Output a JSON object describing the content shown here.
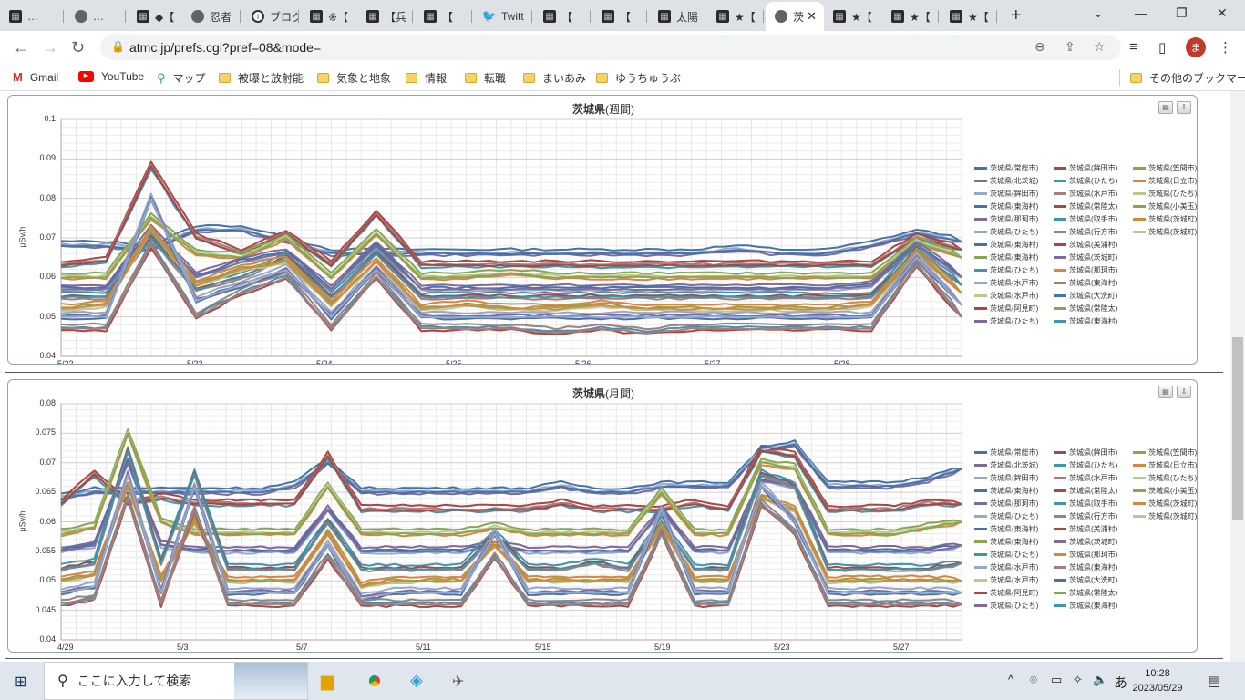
{
  "browser": {
    "tabs": [
      {
        "label": "…",
        "icon": "site-icon",
        "active": false
      },
      {
        "label": "…",
        "icon": "globe-icon",
        "active": false
      },
      {
        "label": "◆【",
        "icon": "site-icon",
        "active": false
      },
      {
        "label": "忍者",
        "icon": "globe-icon",
        "active": false
      },
      {
        "label": "ブログ",
        "icon": "info-icon",
        "active": false
      },
      {
        "label": "※【",
        "icon": "site-icon",
        "active": false
      },
      {
        "label": "【兵",
        "icon": "site-icon",
        "active": false
      },
      {
        "label": "【",
        "icon": "site-icon",
        "active": false
      },
      {
        "label": "Twitt",
        "icon": "twitter-icon",
        "active": false
      },
      {
        "label": "【",
        "icon": "site-icon",
        "active": false
      },
      {
        "label": "【",
        "icon": "site-icon",
        "active": false
      },
      {
        "label": "太陽",
        "icon": "site-icon",
        "active": false
      },
      {
        "label": "★【",
        "icon": "site-icon",
        "active": false
      },
      {
        "label": "茨",
        "icon": "globe-icon",
        "active": true
      },
      {
        "label": "★【",
        "icon": "site-icon",
        "active": false
      },
      {
        "label": "★【",
        "icon": "site-icon",
        "active": false
      },
      {
        "label": "★【",
        "icon": "site-icon",
        "active": false
      }
    ],
    "url": "atmc.jp/prefs.cgi?pref=08&mode=",
    "avatar_letter": "ま",
    "bookmarks": [
      {
        "label": "Gmail",
        "icon": "gmail-icon"
      },
      {
        "label": "YouTube",
        "icon": "youtube-icon"
      },
      {
        "label": "マップ",
        "icon": "maps-icon"
      },
      {
        "label": "被曝と放射能",
        "icon": "folder-icon"
      },
      {
        "label": "気象と地象",
        "icon": "folder-icon"
      },
      {
        "label": "情報",
        "icon": "folder-icon"
      },
      {
        "label": "転職",
        "icon": "folder-icon"
      },
      {
        "label": "まいあみ",
        "icon": "folder-icon"
      },
      {
        "label": "ゆうちゅうぶ",
        "icon": "folder-icon"
      }
    ],
    "other_bookmarks": "その他のブックマーク"
  },
  "legend": [
    "茨城県(常総市)",
    "茨城県(鉾田市)",
    "茨城県(笠間市)",
    "茨城県(北茨城)",
    "茨城県(ひたち)",
    "茨城県(日立市)",
    "茨城県(鉾田市)",
    "茨城県(水戸市)",
    "茨城県(ひたち)",
    "茨城県(東海村)",
    "茨城県(常陸太)",
    "茨城県(小美玉)",
    "茨城県(那珂市)",
    "茨城県(取手市)",
    "茨城県(茨城町)",
    "茨城県(ひたち)",
    "茨城県(行方市)",
    "茨城県(茨城町)",
    "茨城県(東海村)",
    "茨城県(美浦村)",
    "茨城県(東海村)",
    "茨城県(茨城町)",
    "茨城県(ひたち)",
    "茨城県(那珂市)",
    "茨城県(水戸市)",
    "茨城県(東海村)",
    "茨城県(水戸市)",
    "茨城県(大洗町)",
    "茨城県(阿見町)",
    "茨城県(常陸太)",
    "茨城県(ひたち)",
    "茨城県(東海村)"
  ],
  "chart_data": [
    {
      "type": "line",
      "title": "茨城県",
      "subtitle": "(週間)",
      "ylabel": "μSv/h",
      "ylim": [
        0.04,
        0.1
      ],
      "yticks": [
        "0.1",
        "0.09",
        "0.08",
        "0.07",
        "0.06",
        "0.05",
        "0.04"
      ],
      "xticks": [
        "5/22",
        "5/23",
        "5/24",
        "5/25",
        "5/26",
        "5/27",
        "5/28"
      ],
      "series": [
        {
          "name": "茨城県(常総市)",
          "values": [
            0.068,
            0.068,
            0.067,
            0.072,
            0.072,
            0.069,
            0.066,
            0.066,
            0.066,
            0.066,
            0.066,
            0.066,
            0.066,
            0.066,
            0.066,
            0.067,
            0.066,
            0.066,
            0.068,
            0.071,
            0.069
          ]
        },
        {
          "name": "茨城県(北茨城)",
          "values": [
            0.063,
            0.064,
            0.088,
            0.07,
            0.066,
            0.071,
            0.063,
            0.076,
            0.063,
            0.063,
            0.063,
            0.063,
            0.063,
            0.063,
            0.063,
            0.063,
            0.063,
            0.063,
            0.063,
            0.07,
            0.067
          ]
        },
        {
          "name": "茨城県(鉾田市)",
          "values": [
            0.06,
            0.06,
            0.075,
            0.066,
            0.065,
            0.07,
            0.06,
            0.071,
            0.06,
            0.06,
            0.061,
            0.06,
            0.06,
            0.06,
            0.06,
            0.06,
            0.06,
            0.06,
            0.06,
            0.069,
            0.065
          ]
        },
        {
          "name": "茨城県(東海村)",
          "values": [
            0.057,
            0.057,
            0.072,
            0.06,
            0.064,
            0.066,
            0.057,
            0.068,
            0.057,
            0.057,
            0.057,
            0.057,
            0.057,
            0.057,
            0.057,
            0.057,
            0.057,
            0.057,
            0.058,
            0.068,
            0.06
          ]
        },
        {
          "name": "茨城県(那珂市)",
          "values": [
            0.055,
            0.055,
            0.07,
            0.057,
            0.06,
            0.065,
            0.055,
            0.066,
            0.055,
            0.055,
            0.055,
            0.055,
            0.055,
            0.055,
            0.055,
            0.055,
            0.055,
            0.055,
            0.055,
            0.067,
            0.058
          ]
        },
        {
          "name": "茨城県(鉾田市)",
          "values": [
            0.052,
            0.053,
            0.072,
            0.058,
            0.062,
            0.064,
            0.053,
            0.064,
            0.052,
            0.053,
            0.052,
            0.052,
            0.053,
            0.052,
            0.052,
            0.052,
            0.052,
            0.052,
            0.053,
            0.066,
            0.056
          ]
        },
        {
          "name": "茨城県(ひたち)",
          "values": [
            0.05,
            0.05,
            0.08,
            0.054,
            0.058,
            0.062,
            0.05,
            0.062,
            0.05,
            0.05,
            0.05,
            0.05,
            0.05,
            0.05,
            0.05,
            0.05,
            0.05,
            0.05,
            0.05,
            0.065,
            0.053
          ]
        },
        {
          "name": "茨城県(水戸市)",
          "values": [
            0.047,
            0.047,
            0.068,
            0.05,
            0.056,
            0.06,
            0.047,
            0.06,
            0.047,
            0.047,
            0.047,
            0.046,
            0.047,
            0.046,
            0.047,
            0.047,
            0.047,
            0.047,
            0.047,
            0.063,
            0.05
          ]
        }
      ]
    },
    {
      "type": "line",
      "title": "茨城県",
      "subtitle": "(月間)",
      "ylabel": "μSv/h",
      "ylim": [
        0.04,
        0.08
      ],
      "yticks": [
        "0.08",
        "0.075",
        "0.07",
        "0.065",
        "0.06",
        "0.055",
        "0.05",
        "0.045",
        "0.04"
      ],
      "xticks": [
        "4/29",
        "5/3",
        "5/7",
        "5/11",
        "5/15",
        "5/19",
        "5/23",
        "5/27"
      ],
      "series": [
        {
          "name": "茨城県(常総市)",
          "values": [
            0.064,
            0.065,
            0.065,
            0.065,
            0.065,
            0.065,
            0.065,
            0.066,
            0.07,
            0.065,
            0.065,
            0.065,
            0.065,
            0.065,
            0.065,
            0.066,
            0.065,
            0.065,
            0.066,
            0.066,
            0.066,
            0.072,
            0.073,
            0.066,
            0.066,
            0.066,
            0.067,
            0.069
          ]
        },
        {
          "name": "茨城県(北茨城)",
          "values": [
            0.063,
            0.068,
            0.063,
            0.064,
            0.063,
            0.063,
            0.063,
            0.063,
            0.071,
            0.062,
            0.062,
            0.062,
            0.062,
            0.062,
            0.062,
            0.063,
            0.062,
            0.062,
            0.062,
            0.063,
            0.062,
            0.072,
            0.071,
            0.062,
            0.062,
            0.062,
            0.063,
            0.063
          ]
        },
        {
          "name": "茨城県(鉾田市)",
          "values": [
            0.058,
            0.059,
            0.075,
            0.06,
            0.058,
            0.058,
            0.058,
            0.058,
            0.066,
            0.058,
            0.058,
            0.058,
            0.058,
            0.059,
            0.058,
            0.058,
            0.058,
            0.058,
            0.065,
            0.058,
            0.058,
            0.07,
            0.069,
            0.058,
            0.058,
            0.058,
            0.059,
            0.06
          ]
        },
        {
          "name": "茨城県(東海村)",
          "values": [
            0.055,
            0.056,
            0.07,
            0.056,
            0.055,
            0.055,
            0.055,
            0.055,
            0.062,
            0.055,
            0.055,
            0.055,
            0.055,
            0.056,
            0.055,
            0.055,
            0.055,
            0.055,
            0.062,
            0.055,
            0.055,
            0.067,
            0.066,
            0.055,
            0.055,
            0.055,
            0.055,
            0.056
          ]
        },
        {
          "name": "茨城県(那珂市)",
          "values": [
            0.052,
            0.053,
            0.072,
            0.053,
            0.068,
            0.052,
            0.052,
            0.052,
            0.06,
            0.052,
            0.052,
            0.052,
            0.052,
            0.058,
            0.052,
            0.052,
            0.053,
            0.052,
            0.06,
            0.052,
            0.052,
            0.068,
            0.066,
            0.052,
            0.052,
            0.052,
            0.052,
            0.053
          ]
        },
        {
          "name": "茨城県(鉾田市)",
          "values": [
            0.05,
            0.051,
            0.066,
            0.05,
            0.06,
            0.05,
            0.05,
            0.05,
            0.058,
            0.049,
            0.05,
            0.05,
            0.05,
            0.056,
            0.05,
            0.05,
            0.05,
            0.05,
            0.059,
            0.05,
            0.05,
            0.064,
            0.062,
            0.05,
            0.05,
            0.05,
            0.05,
            0.05
          ]
        },
        {
          "name": "茨城県(ひたち)",
          "values": [
            0.048,
            0.049,
            0.068,
            0.048,
            0.066,
            0.048,
            0.048,
            0.048,
            0.056,
            0.047,
            0.048,
            0.048,
            0.048,
            0.058,
            0.048,
            0.048,
            0.048,
            0.048,
            0.062,
            0.048,
            0.048,
            0.066,
            0.06,
            0.048,
            0.048,
            0.048,
            0.048,
            0.048
          ]
        },
        {
          "name": "茨城県(水戸市)",
          "values": [
            0.046,
            0.047,
            0.064,
            0.046,
            0.062,
            0.046,
            0.046,
            0.046,
            0.054,
            0.046,
            0.046,
            0.046,
            0.046,
            0.054,
            0.046,
            0.046,
            0.046,
            0.046,
            0.058,
            0.046,
            0.046,
            0.063,
            0.058,
            0.046,
            0.046,
            0.046,
            0.046,
            0.046
          ]
        }
      ]
    }
  ],
  "taskbar": {
    "search_placeholder": "ここに入力して検索",
    "ime": "あ",
    "time": "10:28",
    "date": "2023/05/29"
  },
  "colors": {
    "series": [
      "#4572a7",
      "#aa4643",
      "#89a54e",
      "#80699b",
      "#3d96ae",
      "#db843d",
      "#92a8cd",
      "#a47d7c",
      "#b5ca92"
    ]
  }
}
